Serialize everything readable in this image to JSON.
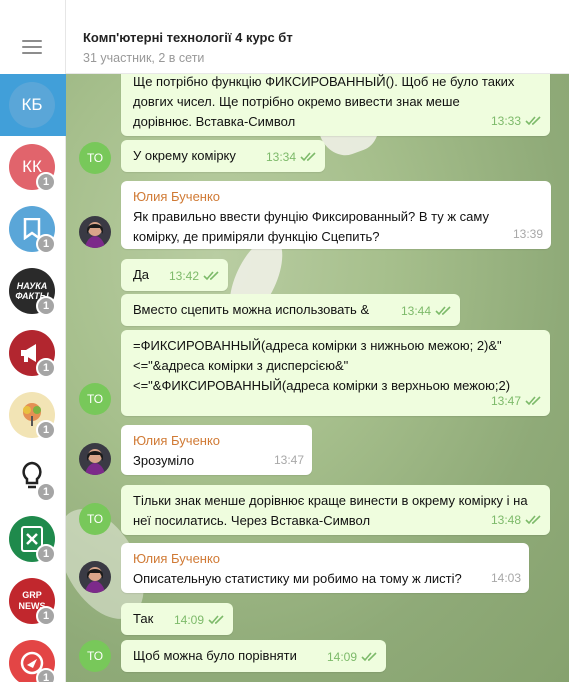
{
  "header": {
    "title": "Комп'ютерні технології 4 курс бт",
    "subtitle": "31 участник, 2 в сети"
  },
  "sidebar": {
    "items": [
      {
        "initials": "КБ",
        "color": "#5aa6d8",
        "badge": ""
      },
      {
        "initials": "КК",
        "color": "#e1646c",
        "badge": "1"
      },
      {
        "icon": "bookmark-icon",
        "color": "#5aa6d8",
        "badge": "1"
      },
      {
        "initials": "НАУКА ФАКТЫ",
        "color": "#2a2a2a",
        "badge": "1"
      },
      {
        "icon": "megaphone-icon",
        "color": "#b2262f",
        "badge": "1"
      },
      {
        "icon": "tree-icon",
        "color": "#f2e4b5",
        "badge": "1"
      },
      {
        "icon": "lightbulb-icon",
        "color": "#ffffff",
        "badge": "1"
      },
      {
        "icon": "excel-icon",
        "color": "#1f8a4c",
        "badge": "1"
      },
      {
        "initials": "GRP NEWS",
        "color": "#c1272d",
        "badge": "1"
      },
      {
        "icon": "channel-icon",
        "color": "#e34545",
        "badge": "1"
      }
    ]
  },
  "messages": [
    {
      "from": "out",
      "text": "Ще потрібно функцію ФИКСИРОВАННЫЙ(). Щоб не було таких довгих чисел. Ще потрібно окремо вивести знак меше дорівнює. Вставка-Символ",
      "time": "13:33"
    },
    {
      "from": "out",
      "avatar": "ТО",
      "text": "У окрему комірку",
      "time": "13:34"
    },
    {
      "from": "in",
      "sender": "Юлия Бученко",
      "text": "Як правильно ввести фунцію Фиксированный? В ту ж саму комірку, де приміряли функцію Сцепить?",
      "time": "13:39"
    },
    {
      "from": "out",
      "text": "Да",
      "time": "13:42"
    },
    {
      "from": "out",
      "text": "Вместо сцепить можна использовать &",
      "time": "13:44"
    },
    {
      "from": "out",
      "avatar": "ТО",
      "text": "=ФИКСИРОВАННЫЙ(адреса комірки з нижньою межою; 2)&\"<=\"&адреса  комірки з дисперсією&\"<=\"&ФИКСИРОВАННЫЙ(адреса комірки з верхньою межою;2)",
      "time": "13:47"
    },
    {
      "from": "in",
      "sender": "Юлия Бученко",
      "text": "Зрозуміло",
      "time": "13:47"
    },
    {
      "from": "out",
      "avatar": "ТО",
      "text": "Тільки знак менше дорівнює краще винести в окрему комірку і на неї посилатись. Через Вставка-Символ",
      "time": "13:48"
    },
    {
      "from": "in",
      "sender": "Юлия Бученко",
      "text": "Описательную статистику ми робимо на тому ж листі?",
      "time": "14:03"
    },
    {
      "from": "out",
      "text": "Так",
      "time": "14:09"
    },
    {
      "from": "out",
      "avatar": "ТО",
      "text": "Щоб можна було порівняти",
      "time": "14:09"
    }
  ],
  "colors": {
    "accent": "#419fd9",
    "outgoing_bubble": "#effdde",
    "sender_name": "#d07a35",
    "check": "#7dba6a"
  }
}
